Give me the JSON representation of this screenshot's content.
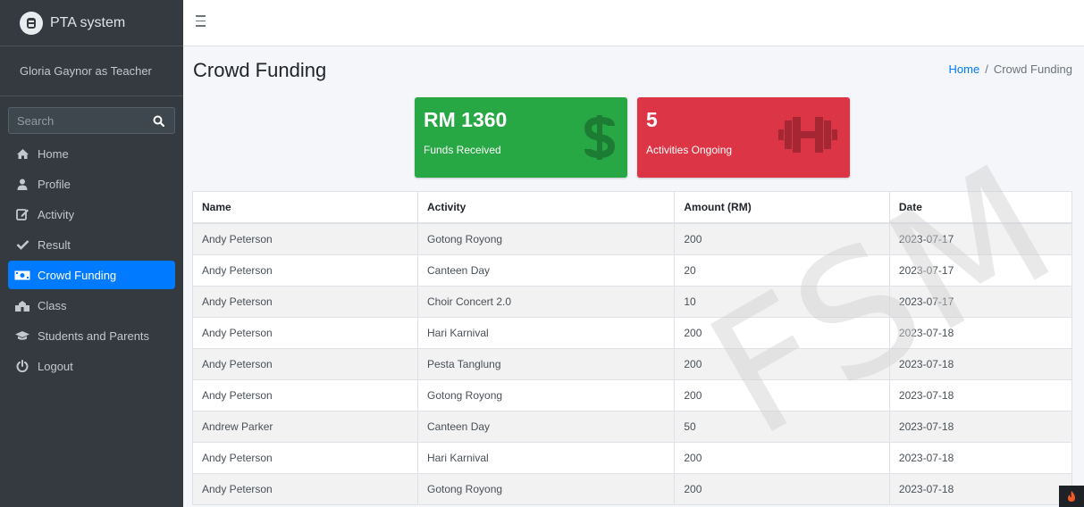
{
  "sidebar": {
    "brand": "PTA system",
    "user": "Gloria Gaynor as Teacher",
    "search_placeholder": "Search",
    "items": [
      {
        "label": "Home",
        "icon": "home-icon"
      },
      {
        "label": "Profile",
        "icon": "user-icon"
      },
      {
        "label": "Activity",
        "icon": "edit-icon"
      },
      {
        "label": "Result",
        "icon": "check-icon"
      },
      {
        "label": "Crowd Funding",
        "icon": "money-bill-icon",
        "active": true
      },
      {
        "label": "Class",
        "icon": "school-icon"
      },
      {
        "label": "Students and Parents",
        "icon": "graduation-cap-icon"
      },
      {
        "label": "Logout",
        "icon": "power-icon"
      }
    ]
  },
  "page": {
    "title": "Crowd Funding",
    "breadcrumb": {
      "home": "Home",
      "current": "Crowd Funding"
    }
  },
  "stats": {
    "funds": {
      "value": "RM 1360",
      "label": "Funds Received",
      "color": "#28a745",
      "icon": "dollar-icon"
    },
    "activities": {
      "value": "5",
      "label": "Activities Ongoing",
      "color": "#dc3545",
      "icon": "dumbbell-icon"
    }
  },
  "table": {
    "headers": [
      "Name",
      "Activity",
      "Amount (RM)",
      "Date"
    ],
    "rows": [
      [
        "Andy Peterson",
        "Gotong Royong",
        "200",
        "2023-07-17"
      ],
      [
        "Andy Peterson",
        "Canteen Day",
        "20",
        "2023-07-17"
      ],
      [
        "Andy Peterson",
        "Choir Concert 2.0",
        "10",
        "2023-07-17"
      ],
      [
        "Andy Peterson",
        "Hari Karnival",
        "200",
        "2023-07-18"
      ],
      [
        "Andy Peterson",
        "Pesta Tanglung",
        "200",
        "2023-07-18"
      ],
      [
        "Andy Peterson",
        "Gotong Royong",
        "200",
        "2023-07-18"
      ],
      [
        "Andrew Parker",
        "Canteen Day",
        "50",
        "2023-07-18"
      ],
      [
        "Andy Peterson",
        "Hari Karnival",
        "200",
        "2023-07-18"
      ],
      [
        "Andy Peterson",
        "Gotong Royong",
        "200",
        "2023-07-18"
      ]
    ]
  },
  "watermark": "FSM"
}
